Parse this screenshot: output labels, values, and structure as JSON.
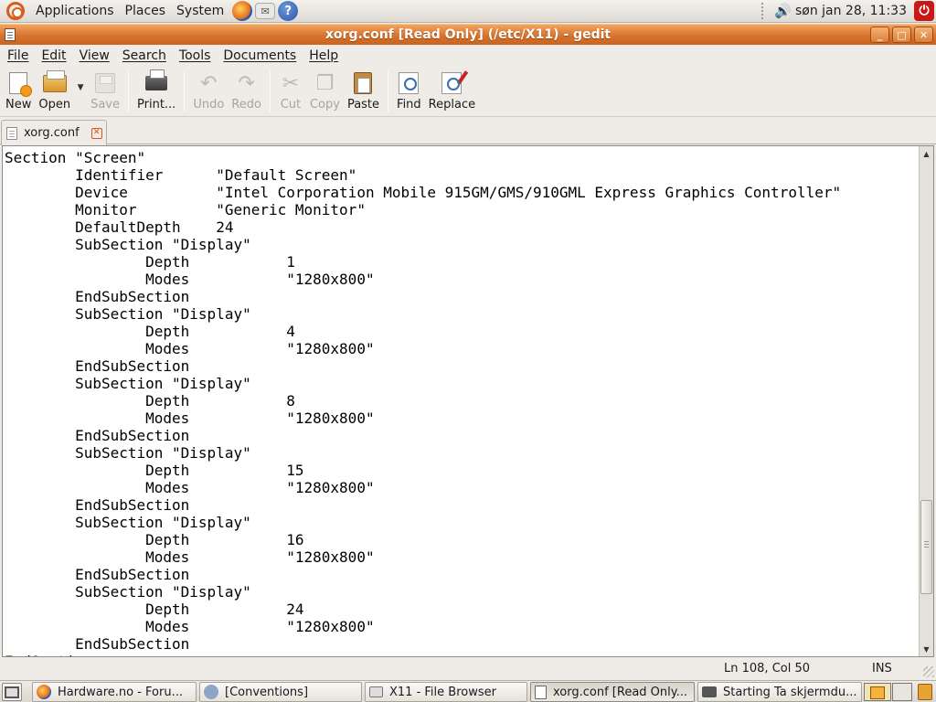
{
  "top_panel": {
    "menus": [
      "Applications",
      "Places",
      "System"
    ],
    "clock": "søn jan 28, 11:33"
  },
  "window": {
    "title": "xorg.conf [Read Only] (/etc/X11) - gedit",
    "buttons": {
      "minimize": "_",
      "maximize": "□",
      "close": "✕"
    }
  },
  "menubar": [
    "File",
    "Edit",
    "View",
    "Search",
    "Tools",
    "Documents",
    "Help"
  ],
  "toolbar": {
    "new": "New",
    "open": "Open",
    "save": "Save",
    "print": "Print...",
    "undo": "Undo",
    "redo": "Redo",
    "cut": "Cut",
    "copy": "Copy",
    "paste": "Paste",
    "find": "Find",
    "replace": "Replace"
  },
  "tab": {
    "label": "xorg.conf"
  },
  "editor": {
    "lines": [
      "Section \"Screen\"",
      "        Identifier      \"Default Screen\"",
      "        Device          \"Intel Corporation Mobile 915GM/GMS/910GML Express Graphics Controller\"",
      "        Monitor         \"Generic Monitor\"",
      "        DefaultDepth    24",
      "        SubSection \"Display\"",
      "                Depth           1",
      "                Modes           \"1280x800\"",
      "        EndSubSection",
      "        SubSection \"Display\"",
      "                Depth           4",
      "                Modes           \"1280x800\"",
      "        EndSubSection",
      "        SubSection \"Display\"",
      "                Depth           8",
      "                Modes           \"1280x800\"",
      "        EndSubSection",
      "        SubSection \"Display\"",
      "                Depth           15",
      "                Modes           \"1280x800\"",
      "        EndSubSection",
      "        SubSection \"Display\"",
      "                Depth           16",
      "                Modes           \"1280x800\"",
      "        EndSubSection",
      "        SubSection \"Display\"",
      "                Depth           24",
      "                Modes           \"1280x800\"",
      "        EndSubSection",
      "EndSection"
    ]
  },
  "statusbar": {
    "position": "Ln 108, Col 50",
    "mode": "INS"
  },
  "taskbar": {
    "tasks": [
      {
        "label": "Hardware.no - Foru...",
        "icon": "firefox-icon"
      },
      {
        "label": "[Conventions]",
        "icon": "help-icon"
      },
      {
        "label": "X11 - File Browser",
        "icon": "file-browser-icon"
      },
      {
        "label": "xorg.conf [Read Only...",
        "icon": "gedit-icon"
      },
      {
        "label": "Starting Ta skjermdu...",
        "icon": "screenshot-icon"
      }
    ]
  }
}
